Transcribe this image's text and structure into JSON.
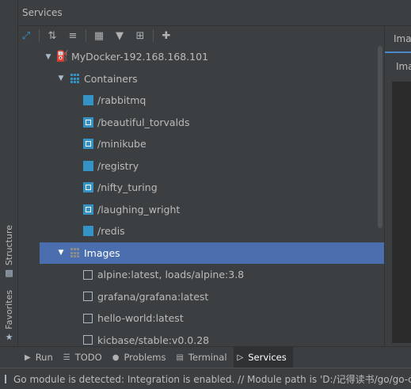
{
  "left_stripe": {
    "structure_label": "Structure",
    "favorites_label": "Favorites"
  },
  "panel": {
    "title": "Services"
  },
  "tree": {
    "root_label": "MyDocker-192.168.168.101",
    "containers_label": "Containers",
    "containers": [
      {
        "name": "/rabbitmq",
        "state": "stopped"
      },
      {
        "name": "/beautiful_torvalds",
        "state": "running"
      },
      {
        "name": "/minikube",
        "state": "running"
      },
      {
        "name": "/registry",
        "state": "stopped"
      },
      {
        "name": "/nifty_turing",
        "state": "running"
      },
      {
        "name": "/laughing_wright",
        "state": "running"
      },
      {
        "name": "/redis",
        "state": "stopped"
      }
    ],
    "images_label": "Images",
    "images": [
      "alpine:latest, loads/alpine:3.8",
      "grafana/grafana:latest",
      "hello-world:latest",
      "kicbase/stable:v0.0.28"
    ]
  },
  "right_panel": {
    "tab_label": "Imag",
    "sub_label": "Ima"
  },
  "bottom_tabs": [
    {
      "label": "Run",
      "icon": "run-icon"
    },
    {
      "label": "TODO",
      "icon": "todo-icon"
    },
    {
      "label": "Problems",
      "icon": "problems-icon"
    },
    {
      "label": "Terminal",
      "icon": "terminal-icon"
    },
    {
      "label": "Services",
      "icon": "services-icon"
    }
  ],
  "status": {
    "message": "Go module is detected: Integration is enabled. // Module path is 'D:/记得读书/go/go-c"
  },
  "colors": {
    "accent": "#3592c4",
    "selection": "#4b6eaf",
    "background": "#3c3f41"
  }
}
